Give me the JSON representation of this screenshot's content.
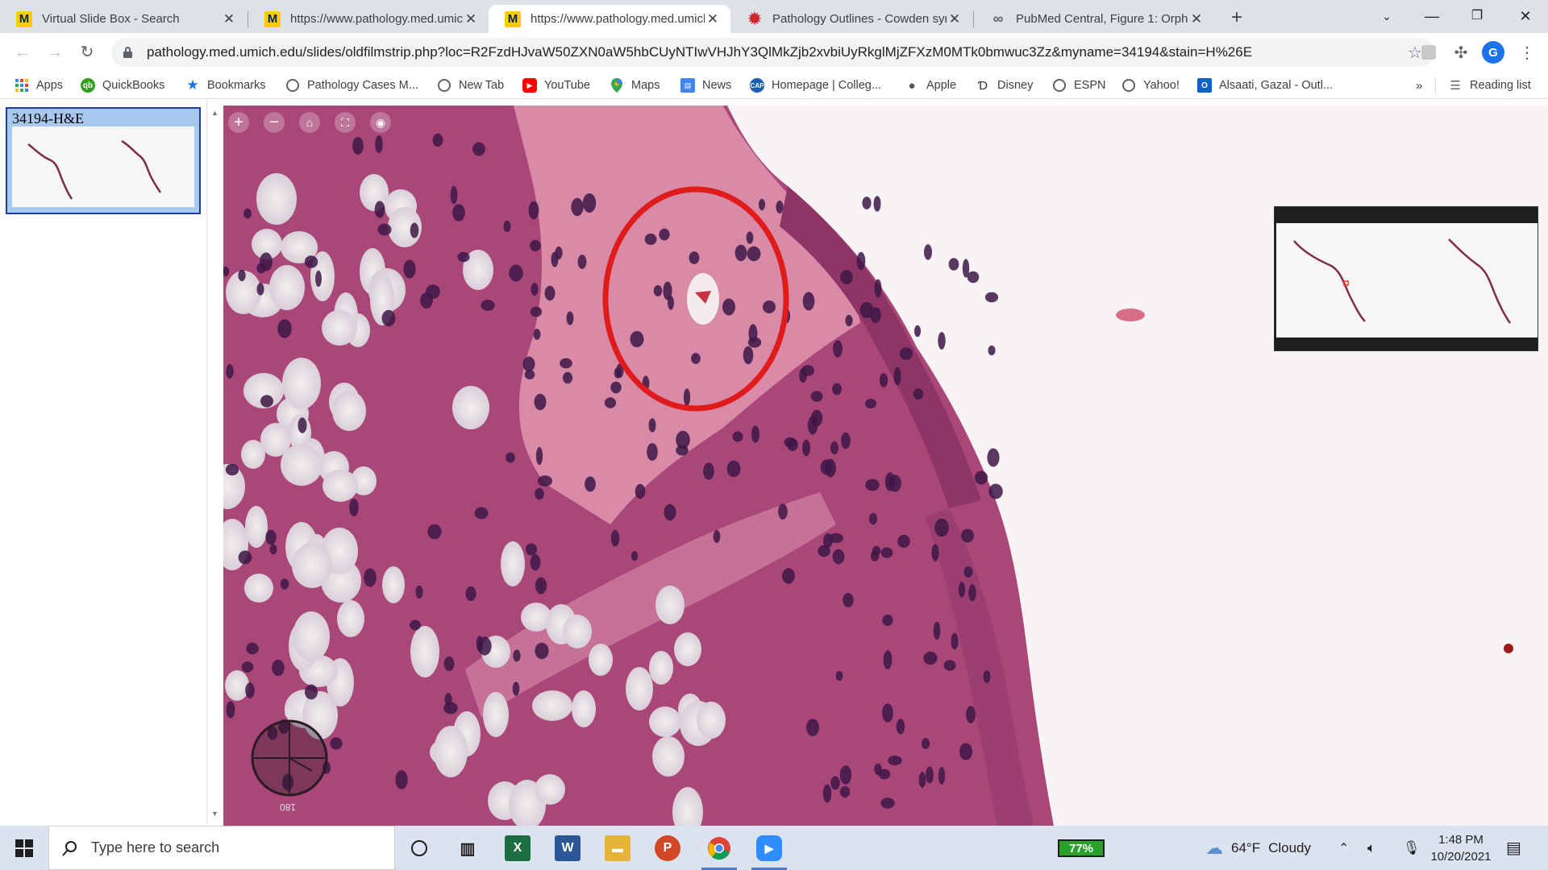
{
  "tabs": [
    {
      "title": "Virtual Slide Box - Search",
      "favicon": "M",
      "active": false
    },
    {
      "title": "https://www.pathology.med.umich",
      "favicon": "M",
      "active": false
    },
    {
      "title": "https://www.pathology.med.umich",
      "favicon": "M",
      "active": true
    },
    {
      "title": "Pathology Outlines - Cowden syn",
      "favicon": "gear",
      "active": false
    },
    {
      "title": "PubMed Central, Figure 1: Orpha",
      "favicon": "link",
      "active": false
    }
  ],
  "address_bar": {
    "url": "pathology.med.umich.edu/slides/oldfilmstrip.php?loc=R2FzdHJvaW50ZXN0aW5hbCUyNTIwVHJhY3QlMkZjb2xvbiUyRkglMjZFXzM0MTk0bmwuc3Zz&myname=34194&stain=H%26E"
  },
  "bookmarks": [
    {
      "label": "Apps",
      "icon": "apps-grid-icon"
    },
    {
      "label": "QuickBooks",
      "icon": "quickbooks-icon"
    },
    {
      "label": "Bookmarks",
      "icon": "star-icon"
    },
    {
      "label": "Pathology Cases M...",
      "icon": "globe-icon"
    },
    {
      "label": "New Tab",
      "icon": "globe-icon"
    },
    {
      "label": "YouTube",
      "icon": "youtube-icon"
    },
    {
      "label": "Maps",
      "icon": "maps-pin-icon"
    },
    {
      "label": "News",
      "icon": "news-icon"
    },
    {
      "label": "Homepage | Colleg...",
      "icon": "cap-icon"
    },
    {
      "label": "Apple",
      "icon": "apple-icon"
    },
    {
      "label": "Disney",
      "icon": "disney-icon"
    },
    {
      "label": "ESPN",
      "icon": "globe-icon"
    },
    {
      "label": "Yahoo!",
      "icon": "globe-icon"
    },
    {
      "label": "Alsaati, Gazal - Outl...",
      "icon": "outlook-icon"
    }
  ],
  "bookmarks_overflow": "»",
  "reading_list": "Reading list",
  "profile_initial": "G",
  "filmstrip": {
    "slide_label": "34194-H&E"
  },
  "viewer": {
    "rotation_top": "0",
    "rotation_bottom": "180"
  },
  "taskbar": {
    "search_placeholder": "Type here to search",
    "battery": "77%",
    "weather_temp": "64°F",
    "weather_text": "Cloudy",
    "time": "1:48 PM",
    "date": "10/20/2021"
  },
  "colors": {
    "annotation_circle": "#e01b1b",
    "tissue_stroma": "#d88aa6",
    "tissue_epithelium": "#a94779",
    "nuclei": "#3d1746",
    "background": "#f8f4f6"
  }
}
